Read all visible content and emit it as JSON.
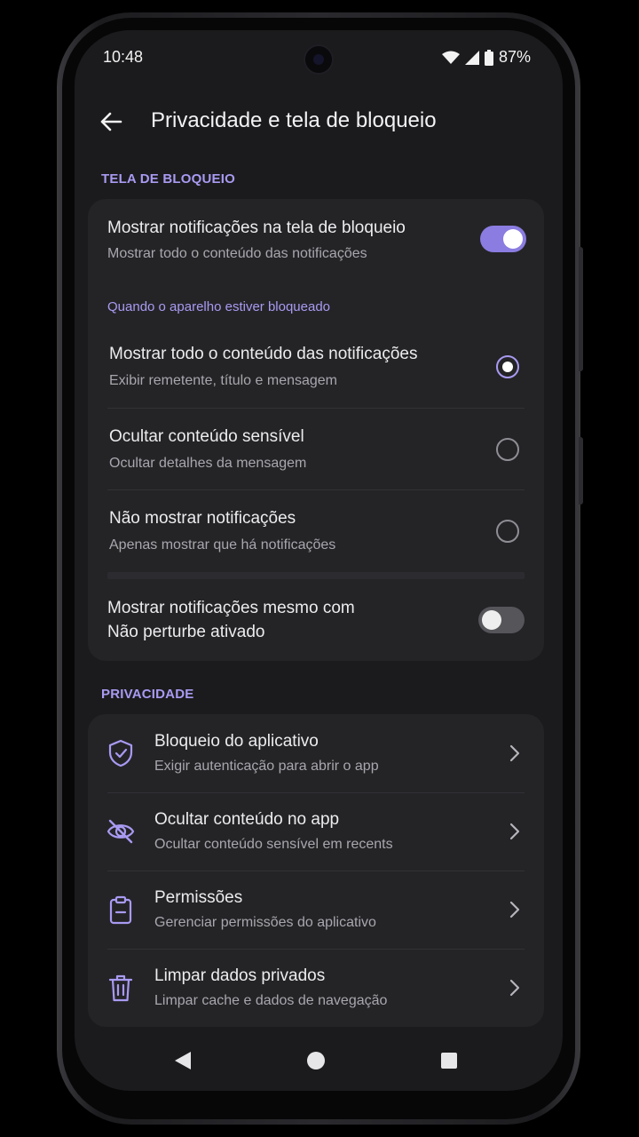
{
  "status": {
    "time": "10:48",
    "battery": "87%"
  },
  "header": {
    "title": "Privacidade e tela de bloqueio"
  },
  "lock_section": {
    "label": "TELA DE BLOQUEIO",
    "show_on_lock": {
      "title": "Mostrar notificações na tela de bloqueio",
      "subtitle": "Mostrar todo o conteúdo das notificações",
      "enabled": true
    },
    "group_label": "Quando o aparelho estiver bloqueado",
    "options": [
      {
        "title": "Mostrar todo o conteúdo das notificações",
        "subtitle": "Exibir remetente, título e mensagem",
        "selected": true
      },
      {
        "title": "Ocultar conteúdo sensível",
        "subtitle": "Ocultar detalhes da mensagem",
        "selected": false
      },
      {
        "title": "Não mostrar notificações",
        "subtitle": "Apenas mostrar que há notificações",
        "selected": false
      }
    ],
    "dnd": {
      "title_line1": "Mostrar notificações mesmo com",
      "title_line2": "Não perturbe ativado",
      "enabled": false
    }
  },
  "privacy_section": {
    "label": "PRIVACIDADE",
    "items": [
      {
        "title": "Bloqueio do aplicativo",
        "subtitle": "Exigir autenticação para abrir o app",
        "icon": "shield-check-icon"
      },
      {
        "title": "Ocultar conteúdo no app",
        "subtitle": "Ocultar conteúdo sensível em recents",
        "icon": "eye-off-icon"
      },
      {
        "title": "Permissões",
        "subtitle": "Gerenciar permissões do aplicativo",
        "icon": "clipboard-icon"
      },
      {
        "title": "Limpar dados privados",
        "subtitle": "Limpar cache e dados de navegação",
        "icon": "trash-icon"
      }
    ]
  },
  "colors": {
    "accent": "#a99af2",
    "toggle_on": "#8a7ce0",
    "background": "#1b1b1d",
    "card": "#242427"
  }
}
